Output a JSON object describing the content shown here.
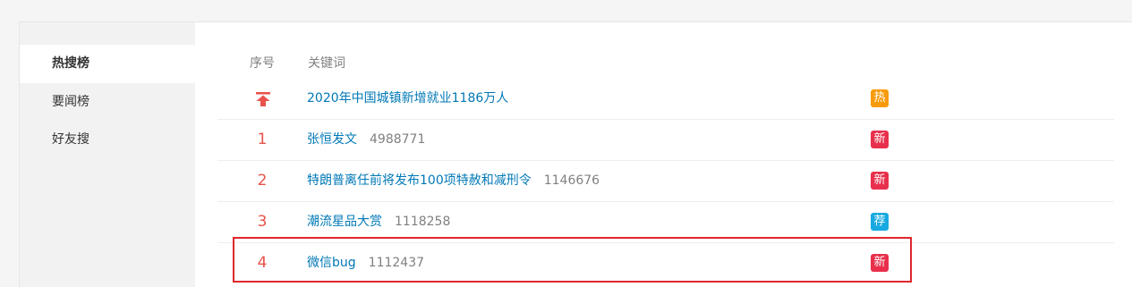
{
  "sidebar": {
    "items": [
      {
        "label": "热搜榜"
      },
      {
        "label": "要闻榜"
      },
      {
        "label": "好友搜"
      }
    ]
  },
  "table": {
    "headers": {
      "rank": "序号",
      "keyword": "关键词"
    },
    "rows": [
      {
        "rank": "",
        "pinned": true,
        "keyword": "2020年中国城镇新增就业1186万人",
        "count": "",
        "badge": "热",
        "badge_color": "#f79b0b"
      },
      {
        "rank": "1",
        "pinned": false,
        "keyword": "张恒发文",
        "count": "4988771",
        "badge": "新",
        "badge_color": "#e8304c"
      },
      {
        "rank": "2",
        "pinned": false,
        "keyword": "特朗普离任前将发布100项特赦和减刑令",
        "count": "1146676",
        "badge": "新",
        "badge_color": "#e8304c"
      },
      {
        "rank": "3",
        "pinned": false,
        "keyword": "潮流星品大赏",
        "count": "1118258",
        "badge": "荐",
        "badge_color": "#18a9e0"
      },
      {
        "rank": "4",
        "pinned": false,
        "keyword": "微信bug",
        "count": "1112437",
        "badge": "新",
        "badge_color": "#e8304c"
      }
    ]
  },
  "colors": {
    "link": "#0078b6",
    "rank": "#e8524a",
    "highlight": "#e0262d"
  },
  "icons": {
    "pinned": "arrow-to-top-icon"
  }
}
